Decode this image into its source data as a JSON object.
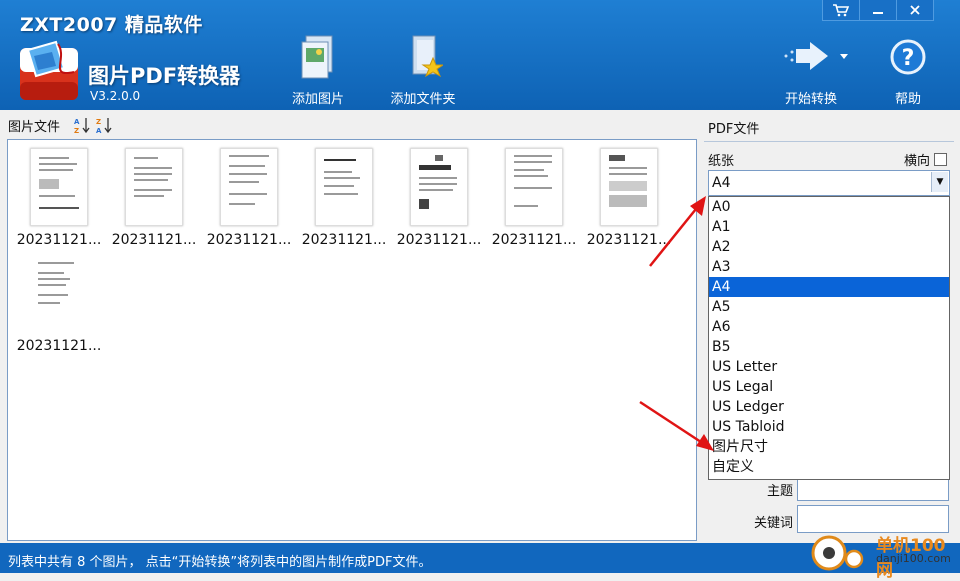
{
  "header": {
    "brand": "ZXT2007 精品软件",
    "app_name": "图片PDF转换器",
    "version": "V3.2.0.0",
    "toolbar": {
      "add_image": "添加图片",
      "add_folder": "添加文件夹",
      "start_convert": "开始转换",
      "help": "帮助"
    }
  },
  "left_panel": {
    "title": "图片文件",
    "items": [
      {
        "name": "20231121..."
      },
      {
        "name": "20231121..."
      },
      {
        "name": "20231121..."
      },
      {
        "name": "20231121..."
      },
      {
        "name": "20231121..."
      },
      {
        "name": "20231121..."
      },
      {
        "name": "20231121..."
      },
      {
        "name": "20231121..."
      }
    ]
  },
  "right_panel": {
    "title": "PDF文件",
    "paper_label": "纸张",
    "landscape_label": "横向",
    "landscape_checked": false,
    "paper_value": "A4",
    "options": [
      "A0",
      "A1",
      "A2",
      "A3",
      "A4",
      "A5",
      "A6",
      "B5",
      "US Letter",
      "US Legal",
      "US Ledger",
      "US Tabloid",
      "图片尺寸",
      "自定义"
    ],
    "selected_index": 4,
    "subject_label": "主题",
    "subject_value": "",
    "keywords_label": "关键词",
    "keywords_value": ""
  },
  "status": {
    "message": "列表中共有 8 个图片， 点击“开始转换”将列表中的图片制作成PDF文件。",
    "watermark_text": "单机100网",
    "watermark_url": "danji100.com"
  },
  "colors": {
    "header_blue": "#1570c8",
    "selection_blue": "#0a64d8",
    "arrow_red": "#e01414"
  }
}
